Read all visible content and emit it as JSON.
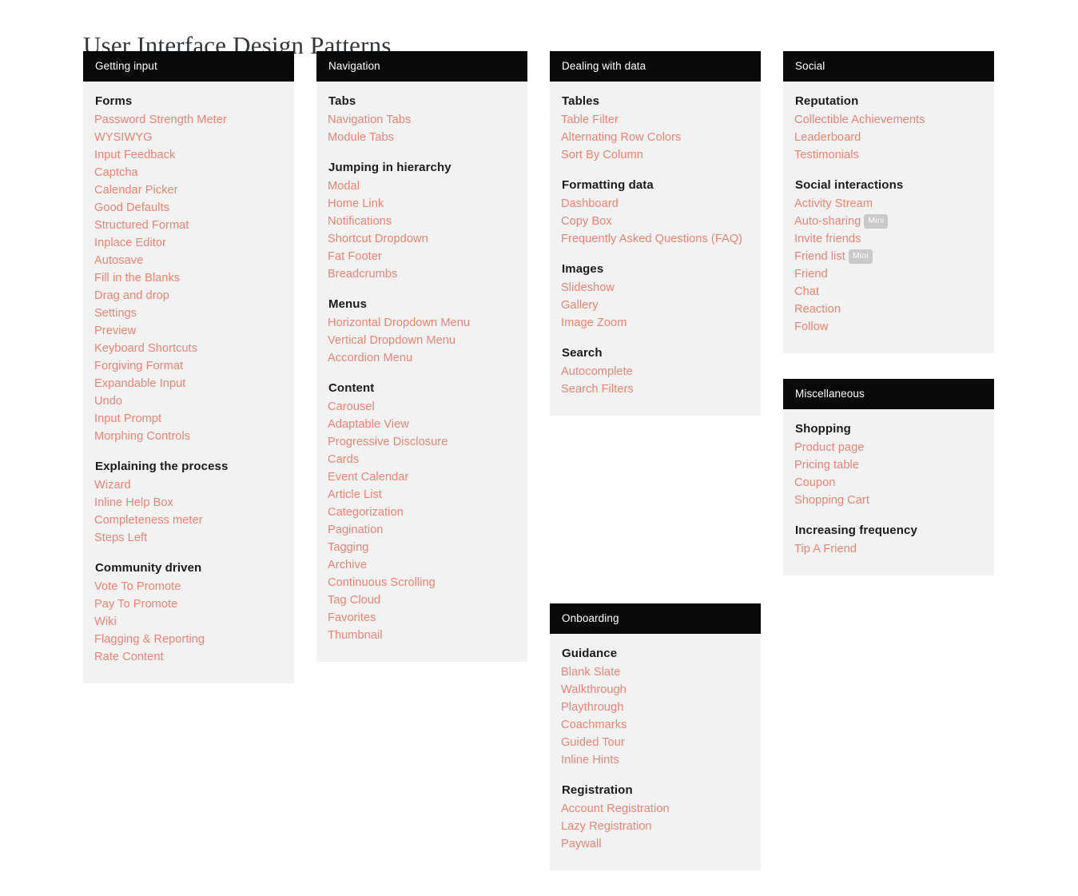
{
  "page": {
    "title": "User Interface Design Patterns",
    "colors": {
      "link": "#ec8373",
      "panel_header_bg": "#0a0a0a",
      "panel_header_text": "#ffffff",
      "panel_bg": "#f2f2f2",
      "group_title": "#1b1b1b",
      "badge_bg": "#c9c9c9",
      "badge_text": "#ffffff",
      "page_bg": "#ffffff"
    }
  },
  "columns": [
    {
      "panels": [
        {
          "header": "Getting input",
          "groups": [
            {
              "title": "Forms",
              "items": [
                {
                  "label": "Password Strength Meter"
                },
                {
                  "label": "WYSIWYG"
                },
                {
                  "label": "Input Feedback"
                },
                {
                  "label": "Captcha"
                },
                {
                  "label": "Calendar Picker"
                },
                {
                  "label": "Good Defaults"
                },
                {
                  "label": "Structured Format"
                },
                {
                  "label": "Inplace Editor"
                },
                {
                  "label": "Autosave"
                },
                {
                  "label": "Fill in the Blanks"
                },
                {
                  "label": "Drag and drop"
                },
                {
                  "label": "Settings"
                },
                {
                  "label": "Preview"
                },
                {
                  "label": "Keyboard Shortcuts"
                },
                {
                  "label": "Forgiving Format"
                },
                {
                  "label": "Expandable Input"
                },
                {
                  "label": "Undo"
                },
                {
                  "label": "Input Prompt"
                },
                {
                  "label": "Morphing Controls"
                }
              ]
            },
            {
              "title": "Explaining the process",
              "items": [
                {
                  "label": "Wizard"
                },
                {
                  "label": "Inline Help Box"
                },
                {
                  "label": "Completeness meter"
                },
                {
                  "label": "Steps Left"
                }
              ]
            },
            {
              "title": "Community driven",
              "items": [
                {
                  "label": "Vote To Promote"
                },
                {
                  "label": "Pay To Promote"
                },
                {
                  "label": "Wiki"
                },
                {
                  "label": "Flagging & Reporting"
                },
                {
                  "label": "Rate Content"
                }
              ]
            }
          ]
        }
      ]
    },
    {
      "panels": [
        {
          "header": "Navigation",
          "groups": [
            {
              "title": "Tabs",
              "items": [
                {
                  "label": "Navigation Tabs"
                },
                {
                  "label": "Module Tabs"
                }
              ]
            },
            {
              "title": "Jumping in hierarchy",
              "items": [
                {
                  "label": "Modal"
                },
                {
                  "label": "Home Link"
                },
                {
                  "label": "Notifications"
                },
                {
                  "label": "Shortcut Dropdown"
                },
                {
                  "label": "Fat Footer"
                },
                {
                  "label": "Breadcrumbs"
                }
              ]
            },
            {
              "title": "Menus",
              "items": [
                {
                  "label": "Horizontal Dropdown Menu"
                },
                {
                  "label": "Vertical Dropdown Menu"
                },
                {
                  "label": "Accordion Menu"
                }
              ]
            },
            {
              "title": "Content",
              "items": [
                {
                  "label": "Carousel"
                },
                {
                  "label": "Adaptable View"
                },
                {
                  "label": "Progressive Disclosure"
                },
                {
                  "label": "Cards"
                },
                {
                  "label": "Event Calendar"
                },
                {
                  "label": "Article List"
                },
                {
                  "label": "Categorization"
                },
                {
                  "label": "Pagination"
                },
                {
                  "label": "Tagging"
                },
                {
                  "label": "Archive"
                },
                {
                  "label": "Continuous Scrolling"
                },
                {
                  "label": "Tag Cloud"
                },
                {
                  "label": "Favorites"
                },
                {
                  "label": "Thumbnail"
                }
              ]
            }
          ]
        }
      ]
    },
    {
      "panels": [
        {
          "header": "Dealing with data",
          "groups": [
            {
              "title": "Tables",
              "items": [
                {
                  "label": "Table Filter"
                },
                {
                  "label": "Alternating Row Colors"
                },
                {
                  "label": "Sort By Column"
                }
              ]
            },
            {
              "title": "Formatting data",
              "items": [
                {
                  "label": "Dashboard"
                },
                {
                  "label": "Copy Box"
                },
                {
                  "label": "Frequently Asked Questions (FAQ)"
                }
              ]
            },
            {
              "title": "Images",
              "items": [
                {
                  "label": "Slideshow"
                },
                {
                  "label": "Gallery"
                },
                {
                  "label": "Image Zoom"
                }
              ]
            },
            {
              "title": "Search",
              "items": [
                {
                  "label": "Autocomplete"
                },
                {
                  "label": "Search Filters"
                }
              ]
            }
          ]
        },
        {
          "header": "Onboarding",
          "spacer_before": true,
          "groups": [
            {
              "title": "Guidance",
              "items": [
                {
                  "label": "Blank Slate"
                },
                {
                  "label": "Walkthrough"
                },
                {
                  "label": "Playthrough"
                },
                {
                  "label": "Coachmarks"
                },
                {
                  "label": "Guided Tour"
                },
                {
                  "label": "Inline Hints"
                }
              ]
            },
            {
              "title": "Registration",
              "items": [
                {
                  "label": "Account Registration"
                },
                {
                  "label": "Lazy Registration"
                },
                {
                  "label": "Paywall"
                }
              ]
            }
          ]
        }
      ]
    },
    {
      "panels": [
        {
          "header": "Social",
          "groups": [
            {
              "title": "Reputation",
              "items": [
                {
                  "label": "Collectible Achievements"
                },
                {
                  "label": "Leaderboard"
                },
                {
                  "label": "Testimonials"
                }
              ]
            },
            {
              "title": "Social interactions",
              "items": [
                {
                  "label": "Activity Stream"
                },
                {
                  "label": "Auto-sharing",
                  "badge": "Mini"
                },
                {
                  "label": "Invite friends"
                },
                {
                  "label": "Friend list",
                  "badge": "Mini"
                },
                {
                  "label": "Friend"
                },
                {
                  "label": "Chat"
                },
                {
                  "label": "Reaction"
                },
                {
                  "label": "Follow"
                }
              ]
            }
          ]
        },
        {
          "header": "Miscellaneous",
          "groups": [
            {
              "title": "Shopping",
              "items": [
                {
                  "label": "Product page"
                },
                {
                  "label": "Pricing table"
                },
                {
                  "label": "Coupon"
                },
                {
                  "label": "Shopping Cart"
                }
              ]
            },
            {
              "title": "Increasing frequency",
              "items": [
                {
                  "label": "Tip A Friend"
                }
              ]
            }
          ]
        }
      ]
    }
  ]
}
